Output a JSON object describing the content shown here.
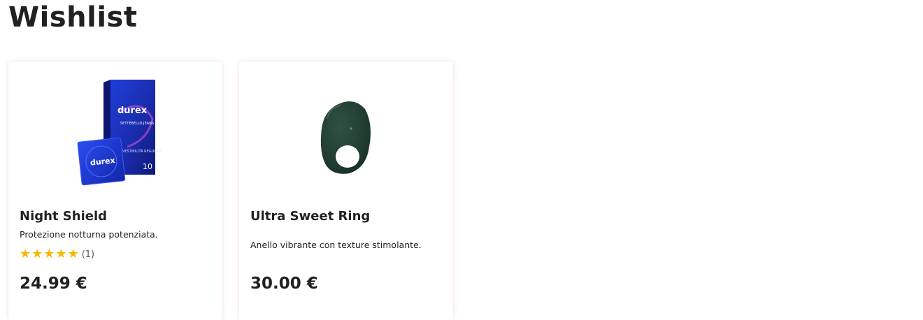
{
  "page": {
    "title": "Wishlist"
  },
  "products": [
    {
      "name": "Night Shield",
      "description": "Protezione notturna potenziata.",
      "rating": {
        "stars": 5,
        "count_label": "(1)"
      },
      "price": "24.99 €",
      "image": {
        "box_brand": "durex",
        "box_line": "SETTEBELLO JEANS",
        "box_fit": "VESTIBILITÀ REGULAR",
        "box_count": "10",
        "wrapper_brand": "durex"
      }
    },
    {
      "name": "Ultra Sweet Ring",
      "description": "Anello vibrante con texture stimolante.",
      "price": "30.00 €",
      "image": {
        "icon": "vibrating-ring"
      }
    }
  ],
  "colors": {
    "star": "#f5b800",
    "ring": "#1f3a2e",
    "box_blue": "#1c2fb8"
  }
}
